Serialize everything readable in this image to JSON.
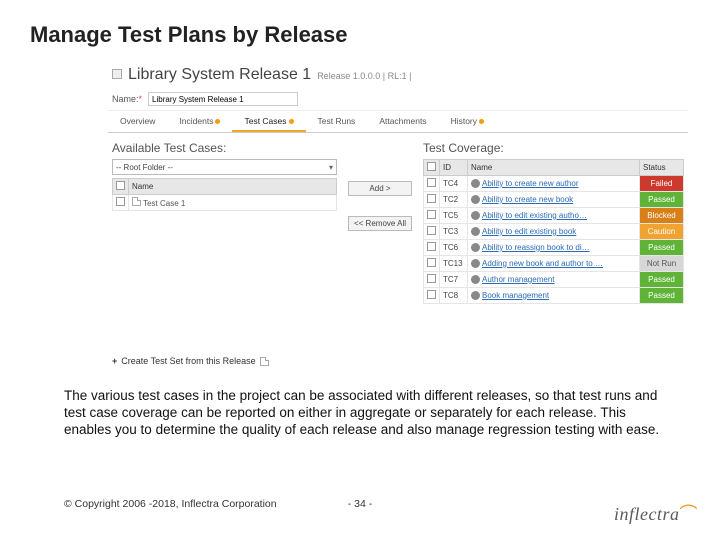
{
  "slide": {
    "title": "Manage Test Plans by Release",
    "body": "The various test cases in the project can be associated with different releases, so that test runs and test case coverage can be reported on either in aggregate or separately for each release. This enables you to determine the quality of each release and also manage regression testing with ease.",
    "copyright": "© Copyright 2006 -2018, Inflectra Corporation",
    "pagenum": "- 34 -",
    "logo_text": "inflectra"
  },
  "app": {
    "release_title": "Library System Release 1",
    "release_meta": "Release 1.0.0.0 | RL:1 |",
    "name_label": "Name:",
    "name_required": "*",
    "name_value": "Library System Release 1",
    "tabs": {
      "overview": "Overview",
      "incidents": "Incidents",
      "testcases": "Test Cases",
      "testruns": "Test Runs",
      "attachments": "Attachments",
      "history": "History"
    },
    "left": {
      "heading": "Available Test Cases:",
      "folder_select": "-- Root Folder --",
      "col_name": "Name",
      "row1": "Test Case 1"
    },
    "mid": {
      "add": "Add >",
      "remove": "<< Remove All"
    },
    "right": {
      "heading": "Test Coverage:",
      "col_id": "ID",
      "col_name": "Name",
      "col_status": "Status",
      "rows": [
        {
          "id": "TC4",
          "name": "Ability to create new author",
          "status": "Failed",
          "cls": "st-failed"
        },
        {
          "id": "TC2",
          "name": "Ability to create new book",
          "status": "Passed",
          "cls": "st-passed"
        },
        {
          "id": "TC5",
          "name": "Ability to edit existing autho…",
          "status": "Blocked",
          "cls": "st-blocked"
        },
        {
          "id": "TC3",
          "name": "Ability to edit existing book",
          "status": "Caution",
          "cls": "st-caution"
        },
        {
          "id": "TC6",
          "name": "Ability to reassign book to di…",
          "status": "Passed",
          "cls": "st-passed"
        },
        {
          "id": "TC13",
          "name": "Adding new book and author to …",
          "status": "Not Run",
          "cls": "st-notrun"
        },
        {
          "id": "TC7",
          "name": "Author management",
          "status": "Passed",
          "cls": "st-passed"
        },
        {
          "id": "TC8",
          "name": "Book management",
          "status": "Passed",
          "cls": "st-passed"
        }
      ]
    },
    "create_set": "Create Test Set from this Release"
  }
}
